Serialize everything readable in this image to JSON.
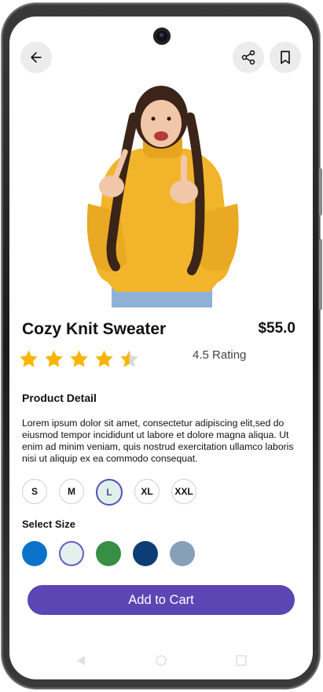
{
  "header": {
    "back_icon": "arrow-left-icon",
    "share_icon": "share-icon",
    "bookmark_icon": "bookmark-icon"
  },
  "product": {
    "name": "Cozy Knit Sweater",
    "price": "$55.0",
    "rating_value": 4.5,
    "rating_max": 5,
    "rating_label": "4.5 Rating",
    "sweater_color": "#f2b42b"
  },
  "detail": {
    "heading": "Product Detail",
    "description": "Lorem ipsum dolor sit amet, consectetur adipiscing  elit,sed do eiusmod tempor incididunt ut labore et  dolore magna aliqua. Ut enim ad minim veniam, quis  nostrud exercitation ullamco laboris nisi ut aliquip  ex ea commodo consequat."
  },
  "sizes": {
    "options": [
      "S",
      "M",
      "L",
      "XL",
      "XXL"
    ],
    "selected": "L"
  },
  "select_size_label": "Select Size",
  "colors": {
    "options": [
      "#0a72c8",
      "#e2f1ec",
      "#378e45",
      "#0d3d75",
      "#85a0b8"
    ],
    "selected_index": 1
  },
  "cart": {
    "label": "Add to Cart"
  },
  "theme": {
    "accent": "#5b46b4",
    "star": "#f7b500"
  }
}
